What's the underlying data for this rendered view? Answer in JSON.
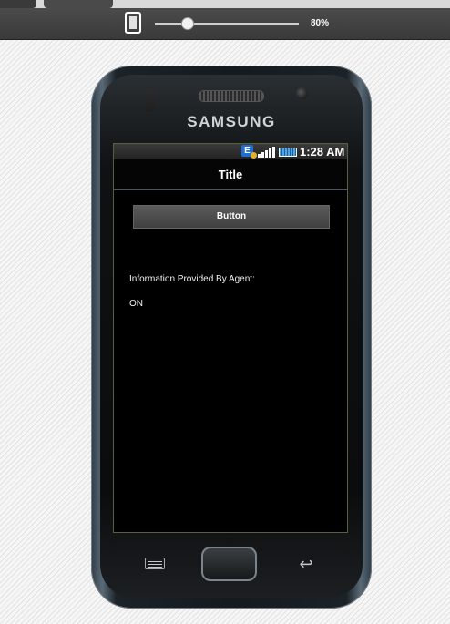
{
  "toolbar": {
    "device_icon": "phone-device-icon",
    "zoom_label": "80%",
    "zoom_value": 80
  },
  "phone": {
    "brand": "SAMSUNG",
    "status": {
      "network_letter": "E",
      "time": "1:28 AM"
    },
    "app": {
      "title": "Title",
      "button_label": "Button",
      "info_label": "Information Provided By Agent:",
      "info_value": "ON"
    },
    "keys": {
      "menu": "menu-icon",
      "home": "home-button",
      "back": "back-arrow-icon"
    }
  },
  "colors": {
    "toolbar": "#3f3f3f",
    "screen_bg": "#000000",
    "button_bg": "#4c4c4c",
    "battery": "#4fa7e8"
  }
}
